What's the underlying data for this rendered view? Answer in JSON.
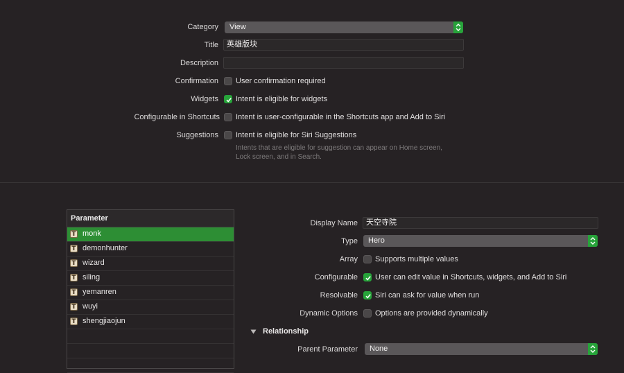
{
  "intent": {
    "category": {
      "label": "Category",
      "value": "View"
    },
    "title": {
      "label": "Title",
      "value": "英雄版块"
    },
    "description": {
      "label": "Description",
      "value": ""
    },
    "confirmation": {
      "label": "Confirmation",
      "text": "User confirmation required",
      "checked": false
    },
    "widgets": {
      "label": "Widgets",
      "text": "Intent is eligible for widgets",
      "checked": true
    },
    "configurable_shortcuts": {
      "label": "Configurable in Shortcuts",
      "text": "Intent is user-configurable in the Shortcuts app and Add to Siri",
      "checked": false
    },
    "suggestions": {
      "label": "Suggestions",
      "text": "Intent is eligible for Siri Suggestions",
      "checked": false,
      "hint_line1": "Intents that are eligible for suggestion can appear on Home screen,",
      "hint_line2": "Lock screen, and in Search."
    }
  },
  "parameters": {
    "header": "Parameter",
    "items": [
      {
        "icon": "T",
        "name": "monk",
        "selected": true
      },
      {
        "icon": "T",
        "name": "demonhunter",
        "selected": false
      },
      {
        "icon": "T",
        "name": "wizard",
        "selected": false
      },
      {
        "icon": "T",
        "name": "siling",
        "selected": false
      },
      {
        "icon": "T",
        "name": "yemanren",
        "selected": false
      },
      {
        "icon": "T",
        "name": "wuyi",
        "selected": false
      },
      {
        "icon": "T",
        "name": "shengjiaojun",
        "selected": false
      }
    ]
  },
  "detail": {
    "display_name": {
      "label": "Display Name",
      "value": "天空寺院"
    },
    "type": {
      "label": "Type",
      "value": "Hero"
    },
    "array": {
      "label": "Array",
      "text": "Supports multiple values",
      "checked": false
    },
    "configurable": {
      "label": "Configurable",
      "text": "User can edit value in Shortcuts, widgets, and Add to Siri",
      "checked": true
    },
    "resolvable": {
      "label": "Resolvable",
      "text": "Siri can ask for value when run",
      "checked": true
    },
    "dynamic_options": {
      "label": "Dynamic Options",
      "text": "Options are provided dynamically",
      "checked": false
    },
    "relationship": {
      "title": "Relationship"
    },
    "parent_parameter": {
      "label": "Parent Parameter",
      "value": "None"
    }
  },
  "colors": {
    "accent": "#27a33a",
    "selection": "#2d8e34",
    "background": "#262224"
  }
}
